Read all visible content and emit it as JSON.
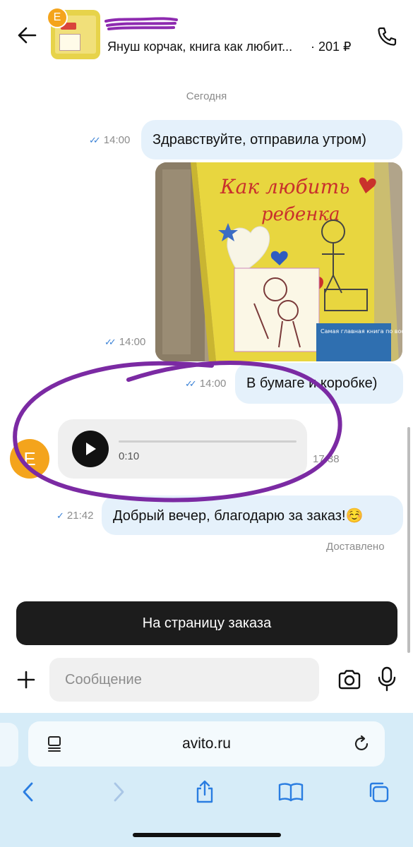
{
  "header": {
    "seller_name": "",
    "avatar_letter": "E",
    "item_title": "Януш корчак, книга как любит...",
    "item_price": "· 201 ₽"
  },
  "chat": {
    "date_separator": "Сегодня",
    "messages": [
      {
        "type": "text",
        "text": "Здравствуйте, отправила утром)",
        "time": "14:00",
        "status": "read"
      },
      {
        "type": "image",
        "description": "book-photo",
        "time": "14:00",
        "status": "read"
      },
      {
        "type": "text",
        "text": "В бумаге и коробке)",
        "time": "14:00",
        "status": "read"
      },
      {
        "type": "voice",
        "duration": "0:10",
        "time": "17:38",
        "sender_avatar": "E"
      },
      {
        "type": "text",
        "text": "Добрый вечер, благодарю за заказ!☺️",
        "time": "21:42",
        "status": "sent"
      }
    ],
    "delivered_label": "Доставлено"
  },
  "photo": {
    "cover_title_line1": "Как любить",
    "cover_title_line2": "ребенка",
    "cover_subtitle": "Самая главная книга по воспитанию детей от рождения до подросткового возраста"
  },
  "bottom": {
    "order_button": "На страницу заказа",
    "message_placeholder": "Сообщение"
  },
  "browser": {
    "url": "avito.ru"
  },
  "colors": {
    "bubble_out": "#e5f1fb",
    "voice_bg": "#efefef",
    "avatar": "#f4a41c",
    "ticks": "#3b82d6",
    "annotation": "#7b2aa3",
    "browser_bg": "#d6ecf8"
  },
  "icons": {
    "back": "arrow-left-icon",
    "phone": "phone-icon",
    "play": "play-icon",
    "plus": "plus-icon",
    "camera": "camera-icon",
    "mic": "mic-icon",
    "reader": "reader-icon",
    "reload": "reload-icon",
    "nav_back": "chevron-left-icon",
    "nav_forward": "chevron-right-icon",
    "share": "share-icon",
    "bookmarks": "book-icon",
    "tabs": "tabs-icon"
  }
}
